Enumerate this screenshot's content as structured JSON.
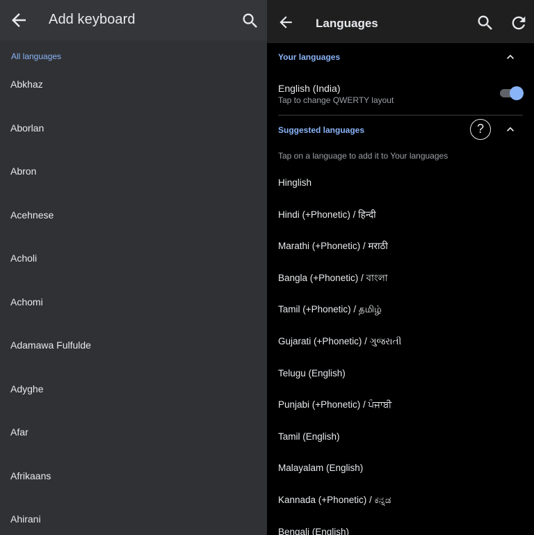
{
  "left": {
    "title": "Add keyboard",
    "section_label": "All languages",
    "items": [
      "Abkhaz",
      "Aborlan",
      "Abron",
      "Acehnese",
      "Acholi",
      "Achomi",
      "Adamawa Fulfulde",
      "Adyghe",
      "Afar",
      "Afrikaans",
      "Ahirani"
    ]
  },
  "right": {
    "title": "Languages",
    "your_languages": {
      "label": "Your languages",
      "language_name": "English (India)",
      "language_sub": "Tap to change QWERTY layout",
      "enabled": true
    },
    "suggested": {
      "label": "Suggested languages",
      "help_glyph": "?",
      "hint": "Tap on a language to add it to Your languages",
      "items": [
        "Hinglish",
        "Hindi (+Phonetic) / हिन्दी",
        "Marathi (+Phonetic) / मराठी",
        "Bangla (+Phonetic) / বাংলা",
        "Tamil (+Phonetic) / தமிழ்",
        "Gujarati (+Phonetic) / ગુજરાતી",
        "Telugu (English)",
        "Punjabi (+Phonetic) / ਪੰਜਾਬੀ",
        "Tamil (English)",
        "Malayalam (English)",
        "Kannada (+Phonetic) / ಕನ್ನಡ",
        "Bengali (English)"
      ]
    }
  },
  "colors": {
    "accent": "#8ab4f8",
    "left_background": "#303134",
    "right_background": "#000000"
  },
  "icons": [
    "back-arrow-icon",
    "search-icon",
    "refresh-icon",
    "chevron-up-icon",
    "help-icon"
  ]
}
